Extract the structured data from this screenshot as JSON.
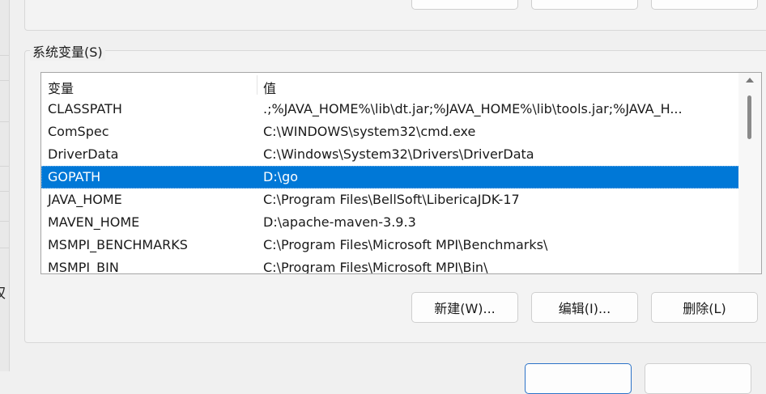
{
  "system_vars": {
    "group_label": "系统变量(S)",
    "columns": [
      "变量",
      "值"
    ],
    "rows": [
      {
        "name": "CLASSPATH",
        "value": ".;%JAVA_HOME%\\lib\\dt.jar;%JAVA_HOME%\\lib\\tools.jar;%JAVA_H..."
      },
      {
        "name": "ComSpec",
        "value": "C:\\WINDOWS\\system32\\cmd.exe"
      },
      {
        "name": "DriverData",
        "value": "C:\\Windows\\System32\\Drivers\\DriverData"
      },
      {
        "name": "GOPATH",
        "value": "D:\\go"
      },
      {
        "name": "JAVA_HOME",
        "value": "C:\\Program Files\\BellSoft\\LibericaJDK-17"
      },
      {
        "name": "MAVEN_HOME",
        "value": "D:\\apache-maven-3.9.3"
      },
      {
        "name": "MSMPI_BENCHMARKS",
        "value": "C:\\Program Files\\Microsoft MPI\\Benchmarks\\"
      },
      {
        "name": "MSMPI_BIN",
        "value": "C:\\Program Files\\Microsoft MPI\\Bin\\"
      }
    ],
    "selected_row": "GOPATH",
    "buttons": {
      "new": "新建(W)...",
      "edit": "编辑(I)...",
      "delete": "删除(L)"
    }
  },
  "left_edge_char": "权",
  "colors": {
    "selection": "#0078d7",
    "accent_border": "#2c73c8"
  }
}
